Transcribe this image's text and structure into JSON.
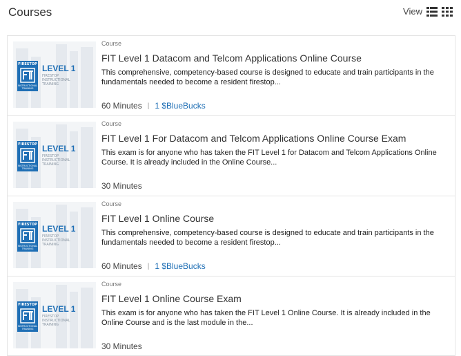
{
  "header": {
    "title": "Courses",
    "view_label": "View",
    "view_list_icon": "list-view-icon",
    "view_grid_icon": "grid-view-icon"
  },
  "colors": {
    "accent": "#1f6fb5",
    "text": "#333333",
    "border": "#e4e4e4"
  },
  "thumbnail": {
    "logo_top": "FIRESTOP",
    "logo_mark": "FIT",
    "logo_bottom": "INSTRUCTIONAL TRAINING",
    "level": "LEVEL 1",
    "level_sub": "FIRESTOP INSTRUCTIONAL TRAINING"
  },
  "courses": [
    {
      "type": "Course",
      "title": "FIT Level 1 Datacom and Telcom Applications Online Course",
      "description": "This comprehensive, competency-based course is designed to educate and train participants in the fundamentals needed to become a resident firestop...",
      "duration": "60 Minutes",
      "separator": "|",
      "bucks": "1 $BlueBucks"
    },
    {
      "type": "Course",
      "title": "FIT Level 1 For Datacom and Telcom Applications Online Course Exam",
      "description": "This exam is for anyone who has taken the FIT Level 1 for Datacom and Telcom Applications Online Course. It is already included in the Online Course...",
      "duration": "30 Minutes",
      "separator": "",
      "bucks": ""
    },
    {
      "type": "Course",
      "title": "FIT Level 1 Online Course",
      "description": "This comprehensive, competency-based course is designed to educate and train participants in the fundamentals needed to become a resident firestop...",
      "duration": "60 Minutes",
      "separator": "|",
      "bucks": "1 $BlueBucks"
    },
    {
      "type": "Course",
      "title": "FIT Level 1 Online Course Exam",
      "description": "This exam is for anyone who has taken the FIT Level 1 Online Course. It is already included in the Online Course and is the last module in the...",
      "duration": "30 Minutes",
      "separator": "",
      "bucks": ""
    }
  ]
}
